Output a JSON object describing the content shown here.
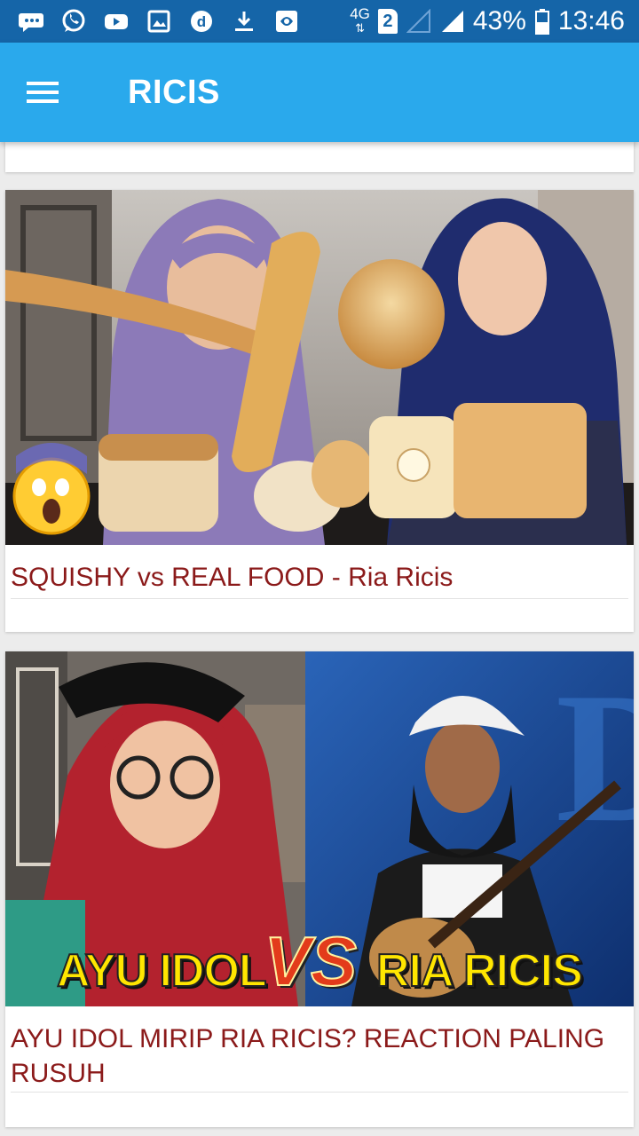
{
  "status_bar": {
    "icons": [
      "messages-icon",
      "whatsapp-icon",
      "youtube-icon",
      "gallery-icon",
      "dana-icon",
      "download-icon",
      "app-icon"
    ],
    "network": "4G",
    "sim": "2",
    "battery": "43%",
    "time": "13:46"
  },
  "app_bar": {
    "title": "RICIS"
  },
  "videos": [
    {
      "title": "SQUISHY vs REAL FOOD - Ria Ricis"
    },
    {
      "title": "AYU IDOL MIRIP RIA RICIS? REACTION PALING RUSUH",
      "thumb_left_text": "AYU IDOL",
      "thumb_vs_text": "VS",
      "thumb_right_text": "RIA RICIS"
    }
  ]
}
